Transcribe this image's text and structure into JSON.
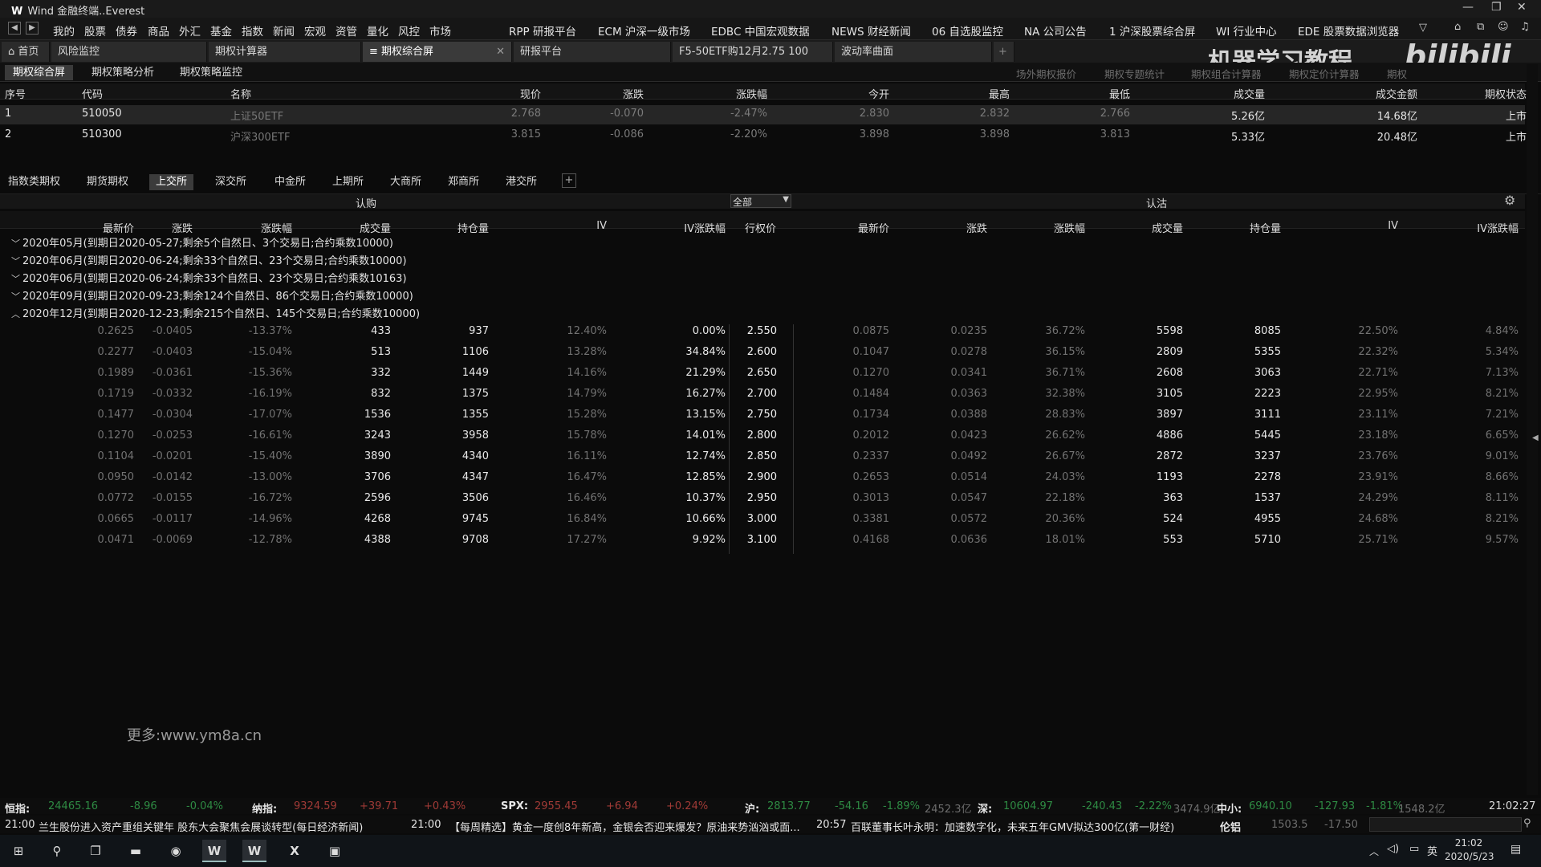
{
  "titlebar": {
    "logo": "W",
    "title": "Wind 金融终端..Everest"
  },
  "menu": {
    "items": [
      "我的",
      "股票",
      "债券",
      "商品",
      "外汇",
      "基金",
      "指数",
      "新闻",
      "宏观",
      "资管",
      "量化",
      "风控",
      "市场"
    ],
    "quick": [
      "RPP 研报平台",
      "ECM 沪深一级市场",
      "EDBC 中国宏观数据",
      "NEWS 财经新闻",
      "06 自选股监控",
      "NA 公司公告",
      "1 沪深股票综合屏",
      "WI 行业中心",
      "EDE 股票数据浏览器"
    ]
  },
  "tabs": [
    {
      "label": "首页"
    },
    {
      "label": "风险监控"
    },
    {
      "label": "期权计算器"
    },
    {
      "label": "期权综合屏"
    },
    {
      "label": "研报平台"
    },
    {
      "label": "F5-50ETF购12月2.75 100"
    },
    {
      "label": "波动率曲面"
    }
  ],
  "watermark": {
    "text": "机器学习教程",
    "brand": "bilibili"
  },
  "subtabs": [
    "期权综合屏",
    "期权策略分析",
    "期权策略监控"
  ],
  "subtabs_right": [
    "场外期权报价",
    "期权专题统计",
    "期权组合计算器",
    "期权定价计算器",
    "期权"
  ],
  "underlying": {
    "headers": [
      "序号",
      "代码",
      "名称",
      "现价",
      "涨跌",
      "涨跌幅",
      "今开",
      "最高",
      "最低",
      "成交量",
      "成交金额",
      "期权状态"
    ],
    "rows": [
      [
        "1",
        "510050",
        "上证50ETF",
        "2.768",
        "-0.070",
        "-2.47%",
        "2.830",
        "2.832",
        "2.766",
        "5.26亿",
        "14.68亿",
        "上市"
      ],
      [
        "2",
        "510300",
        "沪深300ETF",
        "3.815",
        "-0.086",
        "-2.20%",
        "3.898",
        "3.898",
        "3.813",
        "5.33亿",
        "20.48亿",
        "上市"
      ]
    ]
  },
  "exchanges": [
    "指数类期权",
    "期货期权",
    "上交所",
    "深交所",
    "中金所",
    "上期所",
    "大商所",
    "郑商所",
    "港交所"
  ],
  "chain": {
    "call_label": "认购",
    "put_label": "认沽",
    "filter": "全部",
    "headers_call": [
      "最新价",
      "涨跌",
      "涨跌幅",
      "成交量",
      "持仓量",
      "IV",
      "IV涨跌幅"
    ],
    "strike_header": "行权价",
    "headers_put": [
      "最新价",
      "涨跌",
      "涨跌幅",
      "成交量",
      "持仓量",
      "IV",
      "IV涨跌幅"
    ],
    "groups": [
      {
        "label": "2020年05月(到期日2020-05-27;剩余5个自然日、3个交易日;合约乘数10000)",
        "expanded": false
      },
      {
        "label": "2020年06月(到期日2020-06-24;剩余33个自然日、23个交易日;合约乘数10000)",
        "expanded": false
      },
      {
        "label": "2020年06月(到期日2020-06-24;剩余33个自然日、23个交易日;合约乘数10163)",
        "expanded": false
      },
      {
        "label": "2020年09月(到期日2020-09-23;剩余124个自然日、86个交易日;合约乘数10000)",
        "expanded": false
      },
      {
        "label": "2020年12月(到期日2020-12-23;剩余215个自然日、145个交易日;合约乘数10000)",
        "expanded": true
      }
    ],
    "rows": [
      [
        "0.2625",
        "-0.0405",
        "-13.37%",
        "433",
        "937",
        "12.40%",
        "0.00%",
        "2.550",
        "0.0875",
        "0.0235",
        "36.72%",
        "5598",
        "8085",
        "22.50%",
        "4.84%"
      ],
      [
        "0.2277",
        "-0.0403",
        "-15.04%",
        "513",
        "1106",
        "13.28%",
        "34.84%",
        "2.600",
        "0.1047",
        "0.0278",
        "36.15%",
        "2809",
        "5355",
        "22.32%",
        "5.34%"
      ],
      [
        "0.1989",
        "-0.0361",
        "-15.36%",
        "332",
        "1449",
        "14.16%",
        "21.29%",
        "2.650",
        "0.1270",
        "0.0341",
        "36.71%",
        "2608",
        "3063",
        "22.71%",
        "7.13%"
      ],
      [
        "0.1719",
        "-0.0332",
        "-16.19%",
        "832",
        "1375",
        "14.79%",
        "16.27%",
        "2.700",
        "0.1484",
        "0.0363",
        "32.38%",
        "3105",
        "2223",
        "22.95%",
        "8.21%"
      ],
      [
        "0.1477",
        "-0.0304",
        "-17.07%",
        "1536",
        "1355",
        "15.28%",
        "13.15%",
        "2.750",
        "0.1734",
        "0.0388",
        "28.83%",
        "3897",
        "3111",
        "23.11%",
        "7.21%"
      ],
      [
        "0.1270",
        "-0.0253",
        "-16.61%",
        "3243",
        "3958",
        "15.78%",
        "14.01%",
        "2.800",
        "0.2012",
        "0.0423",
        "26.62%",
        "4886",
        "5445",
        "23.18%",
        "6.65%"
      ],
      [
        "0.1104",
        "-0.0201",
        "-15.40%",
        "3890",
        "4340",
        "16.11%",
        "12.74%",
        "2.850",
        "0.2337",
        "0.0492",
        "26.67%",
        "2872",
        "3237",
        "23.76%",
        "9.01%"
      ],
      [
        "0.0950",
        "-0.0142",
        "-13.00%",
        "3706",
        "4347",
        "16.47%",
        "12.85%",
        "2.900",
        "0.2653",
        "0.0514",
        "24.03%",
        "1193",
        "2278",
        "23.91%",
        "8.66%"
      ],
      [
        "0.0772",
        "-0.0155",
        "-16.72%",
        "2596",
        "3506",
        "16.46%",
        "10.37%",
        "2.950",
        "0.3013",
        "0.0547",
        "22.18%",
        "363",
        "1537",
        "24.29%",
        "8.11%"
      ],
      [
        "0.0665",
        "-0.0117",
        "-14.96%",
        "4268",
        "9745",
        "16.84%",
        "10.66%",
        "3.000",
        "0.3381",
        "0.0572",
        "20.36%",
        "524",
        "4955",
        "24.68%",
        "8.21%"
      ],
      [
        "0.0471",
        "-0.0069",
        "-12.78%",
        "4388",
        "9708",
        "17.27%",
        "9.92%",
        "3.100",
        "0.4168",
        "0.0636",
        "18.01%",
        "553",
        "5710",
        "25.71%",
        "9.57%"
      ]
    ]
  },
  "site_watermark": "更多:www.ym8a.cn",
  "index_bar": [
    {
      "name": "恒指:",
      "value": "24465.16",
      "chg": "-8.96",
      "pct": "-0.04%"
    },
    {
      "name": "纳指:",
      "value": "9324.59",
      "chg": "+39.71",
      "pct": "+0.43%"
    },
    {
      "name": "SPX:",
      "value": "2955.45",
      "chg": "+6.94",
      "pct": "+0.24%"
    },
    {
      "name": "沪:",
      "value": "2813.77",
      "chg": "-54.16",
      "pct": "-1.89%",
      "amount": "2452.3亿"
    },
    {
      "name": "深:",
      "value": "10604.97",
      "chg": "-240.43",
      "pct": "-2.22%",
      "amount": "3474.9亿"
    },
    {
      "name": "中小:",
      "value": "6940.10",
      "chg": "-127.93",
      "pct": "-1.81%",
      "amount": "1548.2亿"
    }
  ],
  "clock": "21:02:27",
  "news": [
    {
      "time": "21:00",
      "text": "兰生股份进入资产重组关键年 股东大会聚焦会展谈转型(每日经济新闻)"
    },
    {
      "time": "21:00",
      "text": "【每周精选】黄金一度创8年新高，金银会否迎来爆发？原油来势汹汹或面..."
    },
    {
      "time": "20:57",
      "text": "百联董事长叶永明：加速数字化，未来五年GMV拟达300亿(第一财经)"
    }
  ],
  "commodity": {
    "name": "伦铝",
    "value": "1503.5",
    "chg": "-17.50"
  },
  "taskbar": {
    "time": "21:02",
    "date": "2020/5/23",
    "ime": "英"
  }
}
